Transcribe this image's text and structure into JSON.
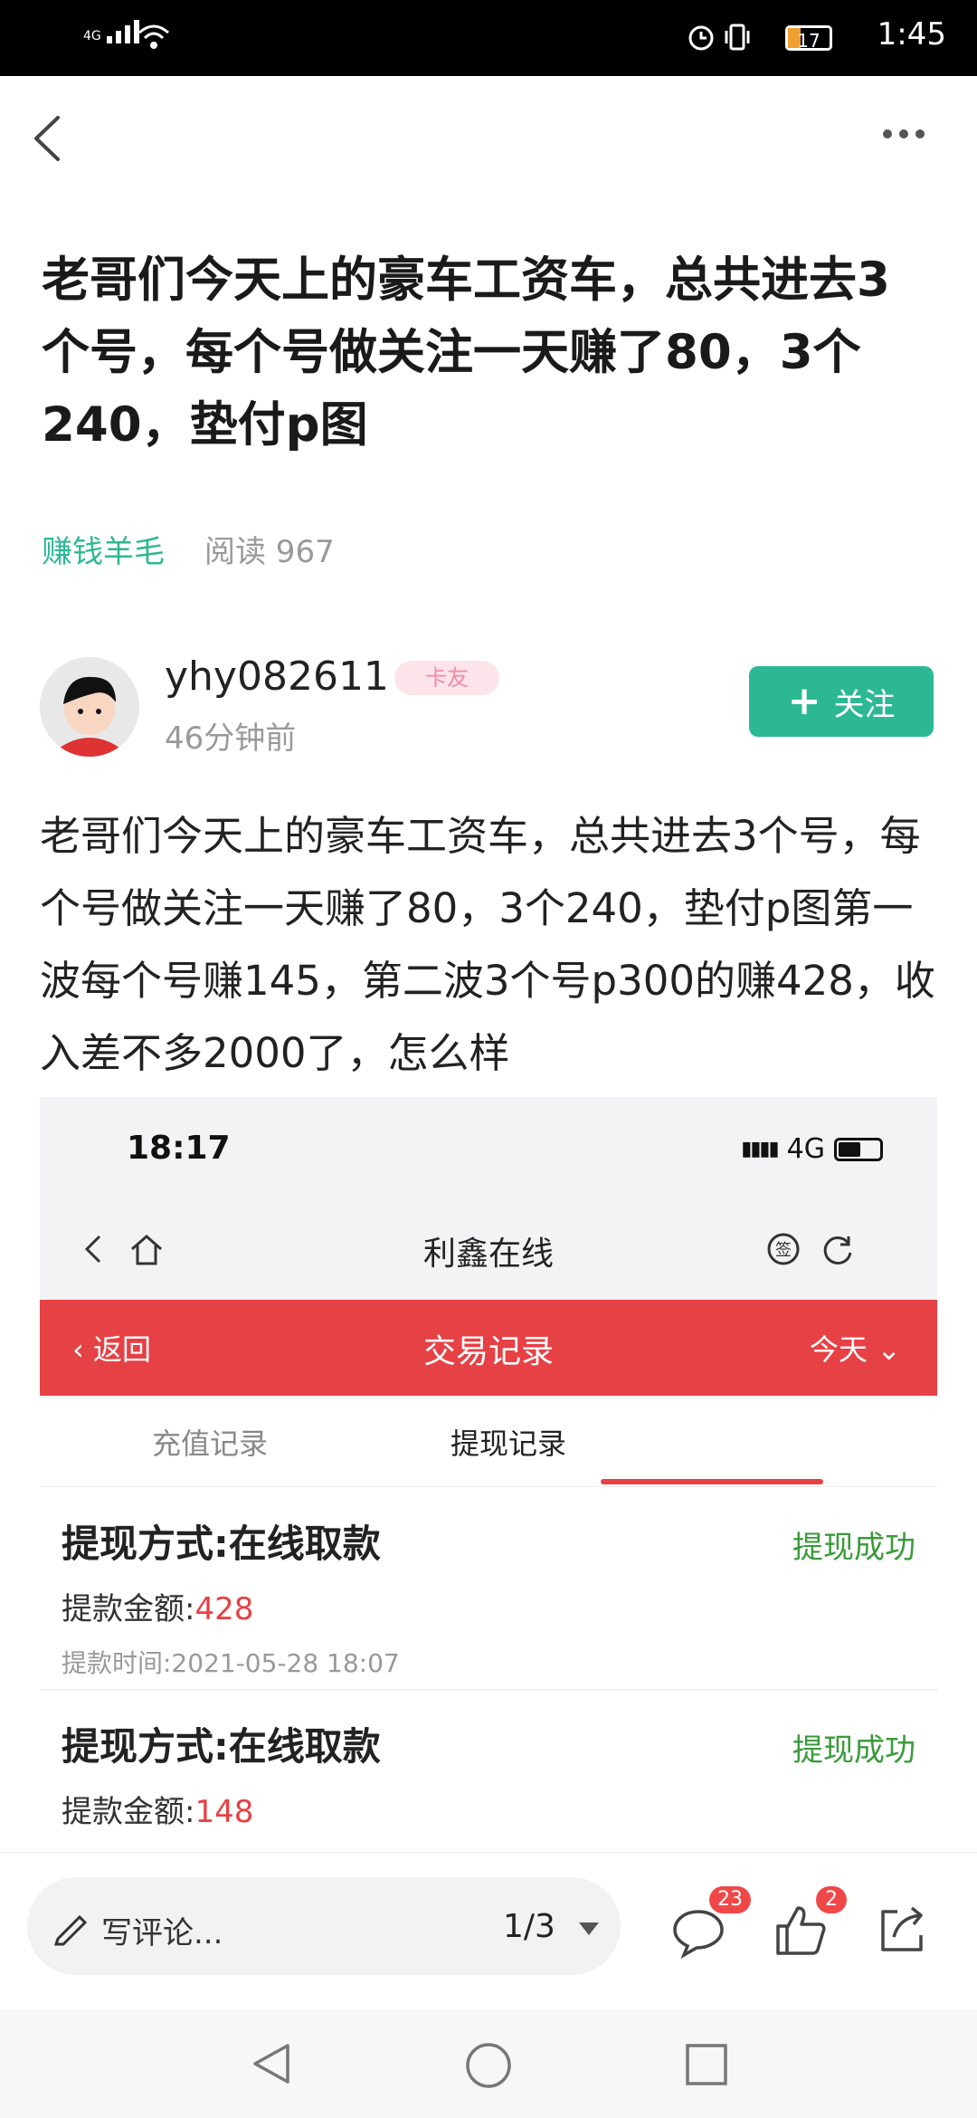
{
  "status_bar": {
    "time": "1:45",
    "network": "4G",
    "battery_level": "17"
  },
  "post": {
    "title": "老哥们今天上的豪车工资车，总共进去3个号，每个号做关注一天赚了80，3个240，垫付p图",
    "category": "赚钱羊毛",
    "read_count": "阅读 967",
    "author": "yhy082611",
    "author_badge": "卡友",
    "time_ago": "46分钟前",
    "follow_label": "关注",
    "body": "老哥们今天上的豪车工资车，总共进去3个号，每个号做关注一天赚了80，3个240，垫付p图第一波每个号赚145，第二波3个号p300的赚428，收入差不多2000了，怎么样"
  },
  "screenshot": {
    "time": "18:17",
    "network": "4G",
    "site_title": "利鑫在线",
    "back_label": "返回",
    "page_title": "交易记录",
    "filter_label": "今天",
    "tabs": [
      "充值记录",
      "提现记录"
    ],
    "records": [
      {
        "method": "提现方式:在线取款",
        "status": "提现成功",
        "amount_label": "提款金额:",
        "amount": "428",
        "time": "提款时间:2021-05-28 18:07"
      },
      {
        "method": "提现方式:在线取款",
        "status": "提现成功",
        "amount_label": "提款金额:",
        "amount": "148",
        "time": ""
      }
    ]
  },
  "bottom_bar": {
    "comment_placeholder": "写评论...",
    "page_indicator": "1/3",
    "comment_count": "23",
    "like_count": "2"
  },
  "icons": [
    "back-icon",
    "more-icon",
    "edit-icon",
    "dropdown-icon",
    "comment-icon",
    "like-icon",
    "share-icon",
    "nav-back-icon",
    "nav-home-icon",
    "nav-recent-icon"
  ],
  "colors": {
    "accent": "#2db894",
    "red": "#e64145"
  }
}
